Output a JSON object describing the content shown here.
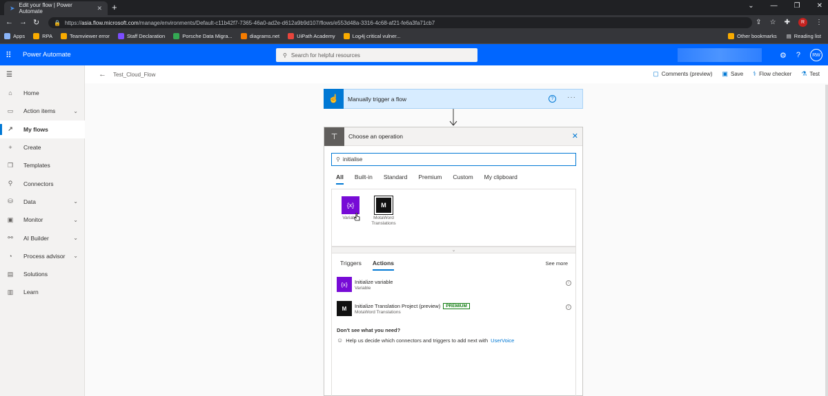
{
  "browser": {
    "tab_title": "Edit your flow | Power Automate",
    "url_host": "asia.flow.microsoft.com",
    "url_path": "/manage/environments/Default-c11b42f7-7365-46a0-ad2e-d612a9b9d107/flows/e553d48a-3316-4c68-af21-fe6a3fa71cb7",
    "url_scheme": "https://",
    "profile_initial": "R",
    "bookmarks": [
      {
        "label": "Apps",
        "color": "#8ab4f8"
      },
      {
        "label": "RPA",
        "color": "#f9ab00"
      },
      {
        "label": "Teamviewer error",
        "color": "#f9ab00"
      },
      {
        "label": "Staff Declaration",
        "color": "#7c4dff"
      },
      {
        "label": "Porsche Data Migra...",
        "color": "#34a853"
      },
      {
        "label": "diagrams.net",
        "color": "#f57c00"
      },
      {
        "label": "UiPath Academy",
        "color": "#e8453c"
      },
      {
        "label": "Log4j critical vulner...",
        "color": "#f9ab00"
      }
    ],
    "other_bookmarks": "Other bookmarks",
    "reading_list": "Reading list"
  },
  "app": {
    "name": "Power Automate",
    "search_placeholder": "Search for helpful resources",
    "avatar_initials": "RW",
    "brand_color": "#0066ff"
  },
  "sidebar": {
    "items": [
      {
        "label": "Home",
        "icon": "home-icon",
        "glyph": "⌂",
        "chev": false
      },
      {
        "label": "Action items",
        "icon": "clipboard-icon",
        "glyph": "▭",
        "chev": true
      },
      {
        "label": "My flows",
        "icon": "flow-icon",
        "glyph": "↗",
        "chev": false
      },
      {
        "label": "Create",
        "icon": "plus-icon",
        "glyph": "+",
        "chev": false
      },
      {
        "label": "Templates",
        "icon": "templates-icon",
        "glyph": "❒",
        "chev": false
      },
      {
        "label": "Connectors",
        "icon": "connectors-icon",
        "glyph": "⚲",
        "chev": false
      },
      {
        "label": "Data",
        "icon": "database-icon",
        "glyph": "⛁",
        "chev": true
      },
      {
        "label": "Monitor",
        "icon": "monitor-icon",
        "glyph": "▣",
        "chev": true
      },
      {
        "label": "AI Builder",
        "icon": "ai-builder-icon",
        "glyph": "⚯",
        "chev": true
      },
      {
        "label": "Process advisor",
        "icon": "process-advisor-icon",
        "glyph": "◔",
        "chev": true
      },
      {
        "label": "Solutions",
        "icon": "solutions-icon",
        "glyph": "▤",
        "chev": false
      },
      {
        "label": "Learn",
        "icon": "book-icon",
        "glyph": "▥",
        "chev": false
      }
    ]
  },
  "toolbar": {
    "flow_name": "Test_Cloud_Flow",
    "comments_label": "Comments (preview)",
    "save_label": "Save",
    "flow_checker_label": "Flow checker",
    "test_label": "Test"
  },
  "trigger": {
    "title": "Manually trigger a flow"
  },
  "operation": {
    "title": "Choose an operation",
    "search_value": "initialise",
    "tabs": [
      "All",
      "Built-in",
      "Standard",
      "Premium",
      "Custom",
      "My clipboard"
    ],
    "connectors": [
      {
        "name": "Variable",
        "icon_text": "{x}"
      },
      {
        "name": "MotaWord Translations",
        "icon_text": "M"
      }
    ],
    "action_tabs": [
      "Triggers",
      "Actions"
    ],
    "see_more": "See more",
    "actions": [
      {
        "title": "Initialize variable",
        "subtitle": "Variable",
        "icon_text": "{x}",
        "premium": ""
      },
      {
        "title": "Initialize Translation Project (preview)",
        "subtitle": "MotaWord Translations",
        "icon_text": "M",
        "premium": "PREMIUM"
      }
    ],
    "dont_see": "Don't see what you need?",
    "help_text": "Help us decide which connectors and triggers to add next with",
    "help_link": "UserVoice"
  }
}
